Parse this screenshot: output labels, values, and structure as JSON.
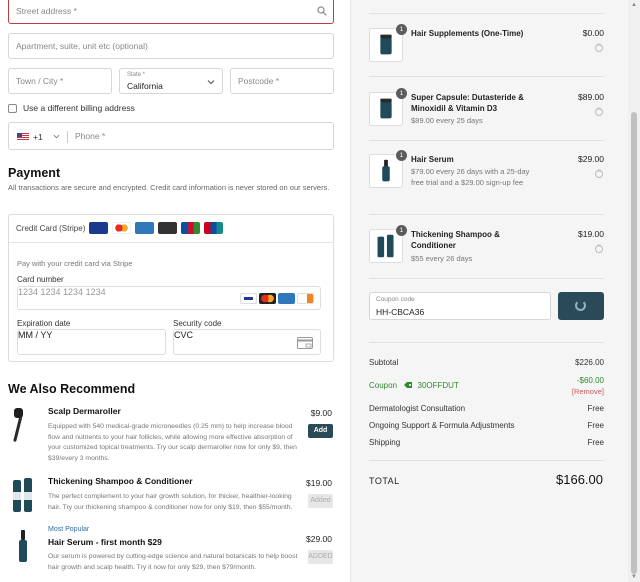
{
  "address": {
    "street_placeholder": "Street address *",
    "apt_placeholder": "Apartment, suite, unit etc (optional)",
    "city_placeholder": "Town / City *",
    "state_label": "State *",
    "state_value": "California",
    "postcode_placeholder": "Postcode *",
    "billing_label": "Use a different billing address",
    "phone_code": "+1",
    "phone_placeholder": "Phone *"
  },
  "payment": {
    "title": "Payment",
    "subtitle": "All transactions are secure and encrypted. Credit card information is never stored on our servers.",
    "method": "Credit Card (Stripe)",
    "note": "Pay with your credit card via Stripe",
    "card_number_label": "Card number",
    "card_number_placeholder": "1234 1234 1234 1234",
    "expiration_label": "Expiration date",
    "expiration_placeholder": "MM / YY",
    "security_label": "Security code",
    "security_placeholder": "CVC"
  },
  "recommend": {
    "title": "We Also Recommend",
    "items": [
      {
        "badge": "",
        "name": "Scalp Dermaroller",
        "desc": "Equipped with 540 medical-grade microneedles (0.25 mm) to help increase blood flow and nutrients to your hair follicles, while allowing more effective absorption of your customized topical treatments. Try our scalp dermaroller now for only $9, then $39/every 3 months.",
        "price": "$9.00",
        "button": "Add"
      },
      {
        "badge": "",
        "name": "Thickening Shampoo & Conditioner",
        "desc": "The perfect complement to your hair growth solution, for thicker, healthier-looking hair. Try our thickening shampoo & conditioner now for only $19, then $55/month.",
        "price": "$19.00",
        "button": "Added"
      },
      {
        "badge": "Most Popular",
        "name": "Hair Serum - first month $29",
        "desc": "Our serum is powered by cutting-edge science and natural botanicals to help boost hair growth and scalp health. Try it now for only $29, then $79/month.",
        "price": "$29.00",
        "button": "ADDED"
      }
    ]
  },
  "cart": {
    "items": [
      {
        "qty": "1",
        "name": "Hair Supplements (One-Time)",
        "sub": "",
        "price": "$0.00"
      },
      {
        "qty": "1",
        "name": "Super Capsule: Dutasteride & Minoxidil & Vitamin D3",
        "sub": "$89.00 every 25 days",
        "price": "$89.00"
      },
      {
        "qty": "1",
        "name": "Hair Serum",
        "sub": "$79.00 every 26 days with a 25-day free trial and a $29.00 sign-up fee",
        "price": "$29.00"
      },
      {
        "qty": "1",
        "name": "Thickening Shampoo & Conditioner",
        "sub": "$55 every 26 days",
        "price": "$19.00"
      }
    ],
    "coupon_label": "Coupon code",
    "coupon_value": "HH-CBCA36"
  },
  "summary": {
    "subtotal_label": "Subtotal",
    "subtotal": "$226.00",
    "coupon_label": "Coupon",
    "coupon_code": "30OFFDUT",
    "coupon_discount": "-$60.00",
    "remove": "[Remove]",
    "derm_label": "Dermatologist Consultation",
    "derm": "Free",
    "support_label": "Ongoing Support & Formula Adjustments",
    "support": "Free",
    "shipping_label": "Shipping",
    "shipping": "Free",
    "total_label": "TOTAL",
    "total": "$166.00"
  },
  "colors": {
    "accent": "#2a4a57",
    "error": "#c43b3b",
    "coupon": "#2e8b2e",
    "remove": "#c85a5a"
  }
}
